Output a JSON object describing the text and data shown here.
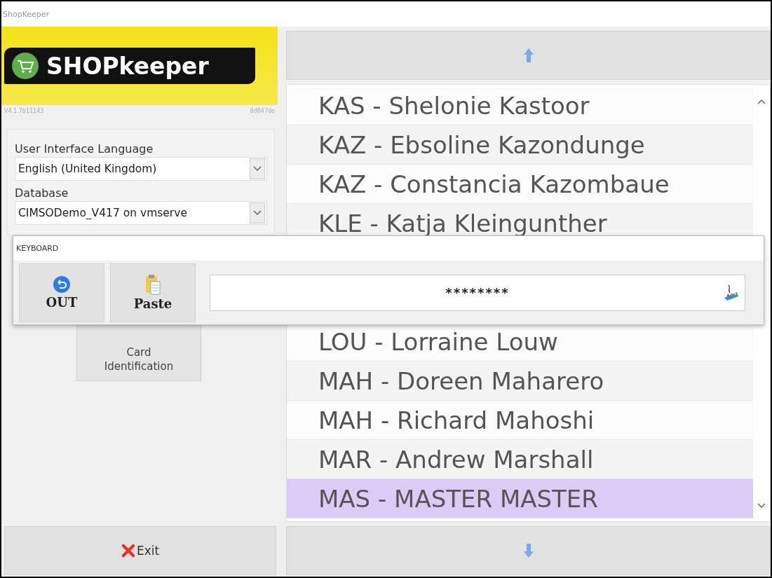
{
  "window": {
    "title": "ShopKeeper"
  },
  "logo": {
    "text": "SHOPkeeper"
  },
  "version": {
    "build": "V4.1.7b11143",
    "hash": "8d847de"
  },
  "settings": [
    {
      "label": "User Interface Language",
      "value": "English (United Kingdom)"
    },
    {
      "label": "Database",
      "value": "CIMSODemo_V417 on vmserve"
    }
  ],
  "card_button": {
    "label": "Card Identification"
  },
  "exit_button": {
    "label": "Exit"
  },
  "user_list": {
    "rows": [
      {
        "label": "KAS - Shelonie Kastoor",
        "selected": false
      },
      {
        "label": "KAZ - Ebsoline Kazondunge",
        "selected": false
      },
      {
        "label": "KAZ - Constancia Kazombaue",
        "selected": false
      },
      {
        "label": "KLE - Katja Kleingunther",
        "selected": false
      },
      {
        "label": "LOU - Lorraine Louw",
        "selected": false
      },
      {
        "label": "MAH - Doreen Maharero",
        "selected": false
      },
      {
        "label": "MAH - Richard Mahoshi",
        "selected": false
      },
      {
        "label": "MAR - Andrew Marshall",
        "selected": false
      },
      {
        "label": "MAS - MASTER MASTER",
        "selected": true
      }
    ]
  },
  "keyboard": {
    "title": "KEYBOARD",
    "buttons": [
      {
        "kind": "out",
        "label": "OUT"
      },
      {
        "kind": "paste",
        "label": "Paste"
      }
    ],
    "input": {
      "value": "********"
    }
  }
}
